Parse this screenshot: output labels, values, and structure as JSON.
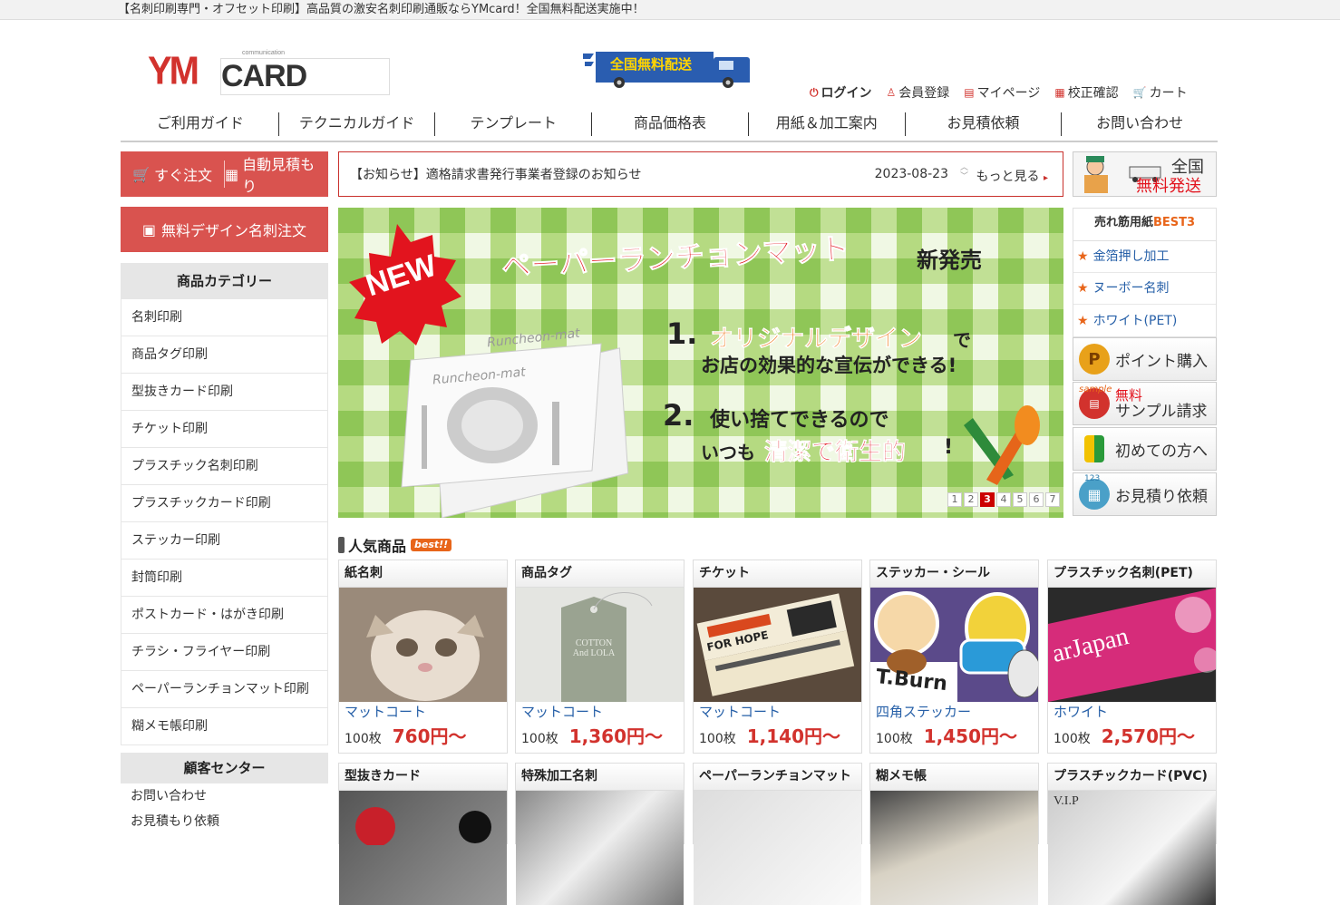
{
  "topbar": {
    "text": "【名刺印刷専門・オフセット印刷】高品質の激安名刺印刷通販ならYMcard！全国無料配送実施中！"
  },
  "logo": {
    "ym": "YM",
    "card": "CARD",
    "sub": "communication"
  },
  "truck": {
    "label": "全国無料配送"
  },
  "util": {
    "login": "ログイン",
    "register": "会員登録",
    "mypage": "マイページ",
    "proof": "校正確認",
    "cart": "カート"
  },
  "gnav": [
    "ご利用ガイド",
    "テクニカルガイド",
    "テンプレート",
    "商品価格表",
    "用紙＆加工案内",
    "お見積依頼",
    "お問い合わせ"
  ],
  "left": {
    "order_now": "すぐ注文",
    "auto_quote": "自動見積もり",
    "free_design": "無料デザイン名刺注文",
    "category_title": "商品カテゴリー",
    "categories": [
      "名刺印刷",
      "商品タグ印刷",
      "型抜きカード印刷",
      "チケット印刷",
      "プラスチック名刺印刷",
      "プラスチックカード印刷",
      "ステッカー印刷",
      "封筒印刷",
      "ポストカード・はがき印刷",
      "チラシ・フライヤー印刷",
      "ペーパーランチョンマット印刷",
      "糊メモ帳印刷"
    ],
    "customer_title": "顧客センター",
    "customer": [
      "お問い合わせ",
      "お見積もり依頼"
    ]
  },
  "notice": {
    "text": "【お知らせ】適格請求書発行事業者登録のお知らせ",
    "date": "2023-08-23",
    "more": "もっと見る"
  },
  "banner": {
    "new": "NEW",
    "title": "ペーパーランチョンマット",
    "release": "新発売",
    "mat_label": "Runcheon-mat",
    "p1_num": "1.",
    "p1_a": "オリジナルデザイン",
    "p1_b": "で",
    "p1_c": "お店の効果的な宣伝ができる!",
    "p2_num": "2.",
    "p2_a": "使い捨てできるので",
    "p2_b": "いつも",
    "p2_c": "清潔で衛生的",
    "p2_d": "!",
    "pages": [
      "1",
      "2",
      "3",
      "4",
      "5",
      "6",
      "7"
    ],
    "current_page": 3
  },
  "right": {
    "freeship_a": "全国",
    "freeship_b": "無料発送",
    "best_title": "売れ筋用紙",
    "best_tag": "BEST3",
    "best_items": [
      "金箔押し加工",
      "ヌーボー名刺",
      "ホワイト(PET)"
    ],
    "best_ranks": [
      "1",
      "2",
      "3"
    ],
    "point": "ポイント購入",
    "sample_tag": "sample",
    "sample_a": "無料",
    "sample_b": "サンプル請求",
    "beginner": "初めての方へ",
    "quote": "お見積り依頼",
    "quote_tag": "123"
  },
  "popular": {
    "title": "人気商品",
    "badge": "best!!",
    "row1": [
      {
        "name": "紙名刺",
        "sub": "マットコート",
        "qty": "100枚",
        "price": "760円〜"
      },
      {
        "name": "商品タグ",
        "sub": "マットコート",
        "qty": "100枚",
        "price": "1,360円〜"
      },
      {
        "name": "チケット",
        "sub": "マットコート",
        "qty": "100枚",
        "price": "1,140円〜"
      },
      {
        "name": "ステッカー・シール",
        "sub": "四角ステッカー",
        "qty": "100枚",
        "price": "1,450円〜"
      },
      {
        "name": "プラスチック名刺(PET)",
        "sub": "ホワイト",
        "qty": "100枚",
        "price": "2,570円〜"
      }
    ],
    "row2": [
      "型抜きカード",
      "特殊加工名刺",
      "ペーパーランチョンマット",
      "糊メモ帳",
      "プラスチックカード(PVC)"
    ]
  },
  "images": {
    "tag_text": "COTTON And LOLA",
    "ticket_text": "FOR HOPE",
    "sticker_text": "T.Burn",
    "pet_text": "arJapan",
    "pvc_text": "V.I.P"
  },
  "colors": {
    "brand_red": "#d9534f",
    "link_blue": "#2760a8",
    "price_red": "#d2322d",
    "banner_green": "#8cc63f"
  }
}
